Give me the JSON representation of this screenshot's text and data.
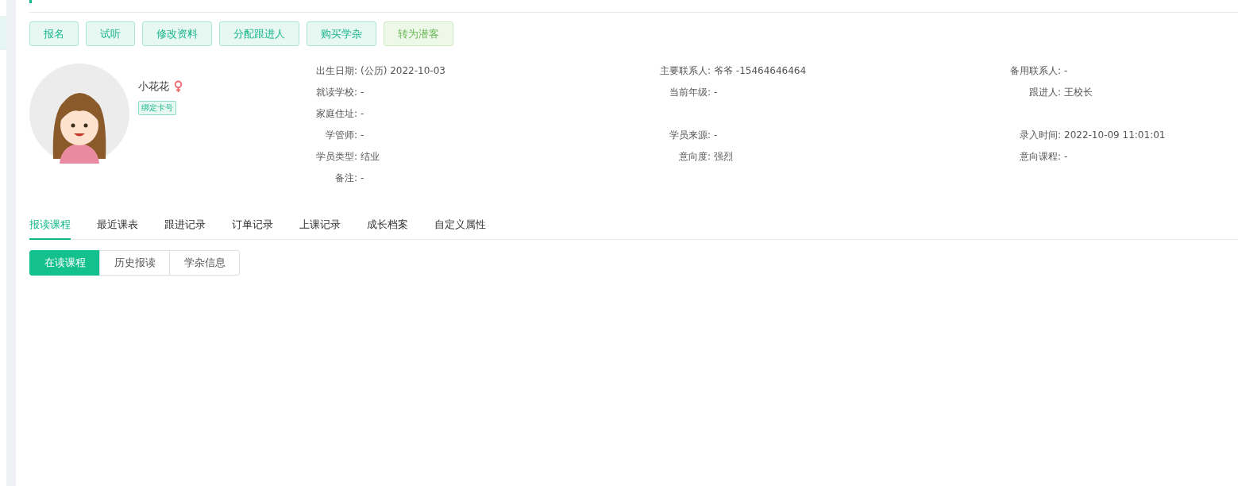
{
  "actions": [
    {
      "label": "报名",
      "kind": "primary"
    },
    {
      "label": "试听",
      "kind": "primary"
    },
    {
      "label": "修改资料",
      "kind": "primary"
    },
    {
      "label": "分配跟进人",
      "kind": "primary"
    },
    {
      "label": "购买学杂",
      "kind": "primary"
    },
    {
      "label": "转为潜客",
      "kind": "secondary"
    }
  ],
  "student": {
    "name": "小花花",
    "female": true,
    "badge": "绑定卡号"
  },
  "info_rows": [
    [
      {
        "label": "出生日期:",
        "value": "(公历) 2022-10-03"
      },
      {
        "label": "主要联系人:",
        "value": "爷爷 -15464646464"
      },
      {
        "label": "备用联系人:",
        "value": "-"
      }
    ],
    [
      {
        "label": "就读学校:",
        "value": "-"
      },
      {
        "label": "当前年级:",
        "value": "-"
      },
      {
        "label": "跟进人:",
        "value": "王校长"
      }
    ],
    [
      {
        "label": "家庭住址:",
        "value": "-"
      },
      null,
      null
    ],
    [
      {
        "label": "学管师:",
        "value": "-"
      },
      {
        "label": "学员来源:",
        "value": "-"
      },
      {
        "label": "录入时间:",
        "value": "2022-10-09 11:01:01"
      }
    ],
    [
      {
        "label": "学员类型:",
        "value": "结业"
      },
      {
        "label": "意向度:",
        "value": "强烈"
      },
      {
        "label": "意向课程:",
        "value": "-"
      }
    ],
    [
      {
        "label": "备注:",
        "value": "-"
      },
      null,
      null
    ]
  ],
  "tabs": [
    {
      "label": "报读课程",
      "selected": true
    },
    {
      "label": "最近课表",
      "selected": false
    },
    {
      "label": "跟进记录",
      "selected": false
    },
    {
      "label": "订单记录",
      "selected": false
    },
    {
      "label": "上课记录",
      "selected": false
    },
    {
      "label": "成长档案",
      "selected": false
    },
    {
      "label": "自定义属性",
      "selected": false
    }
  ],
  "sub_tabs": [
    {
      "label": "在读课程",
      "selected": true
    },
    {
      "label": "历史报读",
      "selected": false
    },
    {
      "label": "学杂信息",
      "selected": false
    }
  ]
}
